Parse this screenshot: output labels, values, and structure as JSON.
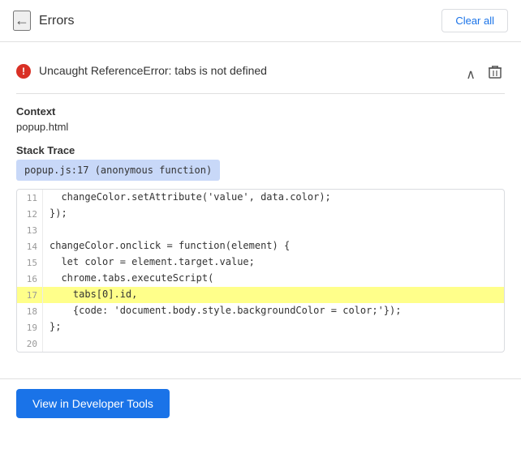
{
  "header": {
    "back_label": "←",
    "title": "Errors",
    "clear_all_label": "Clear all"
  },
  "error": {
    "icon": "!",
    "message": "Uncaught ReferenceError: tabs is not defined",
    "expand_icon": "chevron-up",
    "delete_icon": "trash"
  },
  "context": {
    "label": "Context",
    "value": "popup.html"
  },
  "stack_trace": {
    "label": "Stack Trace",
    "highlight": "popup.js:17 (anonymous function)"
  },
  "code_block": {
    "lines": [
      {
        "num": "11",
        "code": "  changeColor.setAttribute('value', data.color);",
        "highlighted": false
      },
      {
        "num": "12",
        "code": "});",
        "highlighted": false
      },
      {
        "num": "13",
        "code": "",
        "highlighted": false
      },
      {
        "num": "14",
        "code": "changeColor.onclick = function(element) {",
        "highlighted": false
      },
      {
        "num": "15",
        "code": "  let color = element.target.value;",
        "highlighted": false
      },
      {
        "num": "16",
        "code": "  chrome.tabs.executeScript(",
        "highlighted": false
      },
      {
        "num": "17",
        "code": "    tabs[0].id,",
        "highlighted": true
      },
      {
        "num": "18",
        "code": "    {code: 'document.body.style.backgroundColor = color;'});",
        "highlighted": false
      },
      {
        "num": "19",
        "code": "};",
        "highlighted": false
      },
      {
        "num": "20",
        "code": "",
        "highlighted": false
      }
    ]
  },
  "footer": {
    "button_label": "View in Developer Tools"
  }
}
